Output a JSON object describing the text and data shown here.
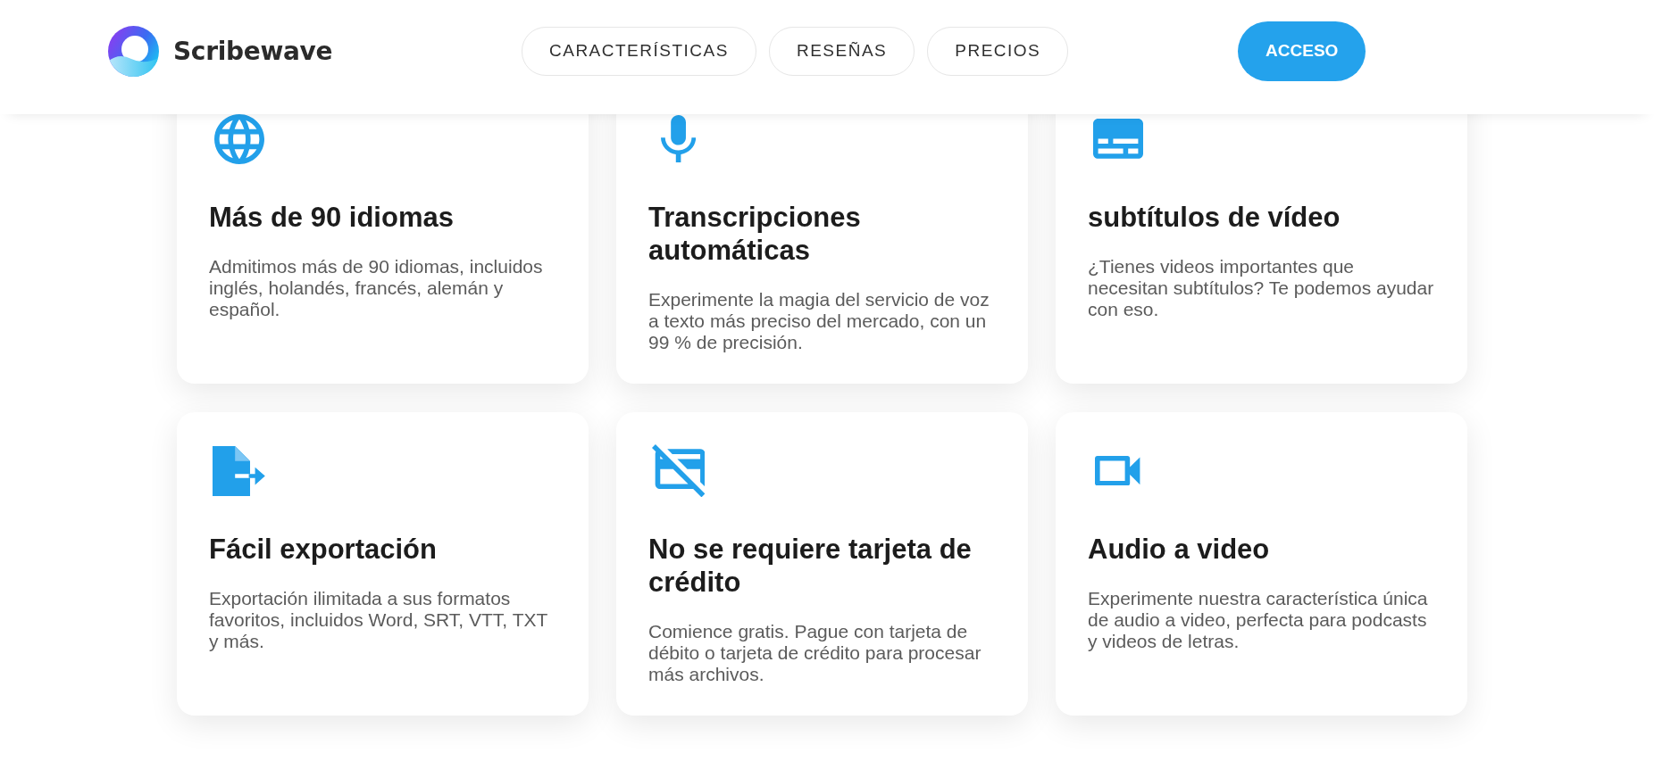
{
  "header": {
    "brand": "Scribewave",
    "nav": [
      "CARACTERÍSTICAS",
      "RESEÑAS",
      "PRECIOS"
    ],
    "login_button": "ACCESO"
  },
  "features": [
    {
      "kind": "globe",
      "title": "Más de 90 idiomas",
      "description": "Admitimos más de 90 idiomas, incluidos inglés, holandés, francés, alemán y español."
    },
    {
      "kind": "microphone",
      "title": "Transcripciones automáticas",
      "description": "Experimente la magia del servicio de voz a texto más preciso del mercado, con un 99 % de precisión."
    },
    {
      "kind": "subtitles",
      "title": "subtítulos de vídeo",
      "description": "¿Tienes videos importantes que necesitan subtítulos? Te podemos ayudar con eso."
    },
    {
      "kind": "export",
      "title": "Fácil exportación",
      "description": "Exportación ilimitada a sus formatos favoritos, incluidos Word, SRT, VTT, TXT y más."
    },
    {
      "kind": "card-off",
      "title": "No se requiere tarjeta de crédito",
      "description": "Comience gratis. Pague con tarjeta de débito o tarjeta de crédito para procesar más archivos."
    },
    {
      "kind": "video",
      "title": "Audio a video",
      "description": "Experimente nuestra característica única de audio a video, perfecta para podcasts y videos de letras."
    }
  ]
}
